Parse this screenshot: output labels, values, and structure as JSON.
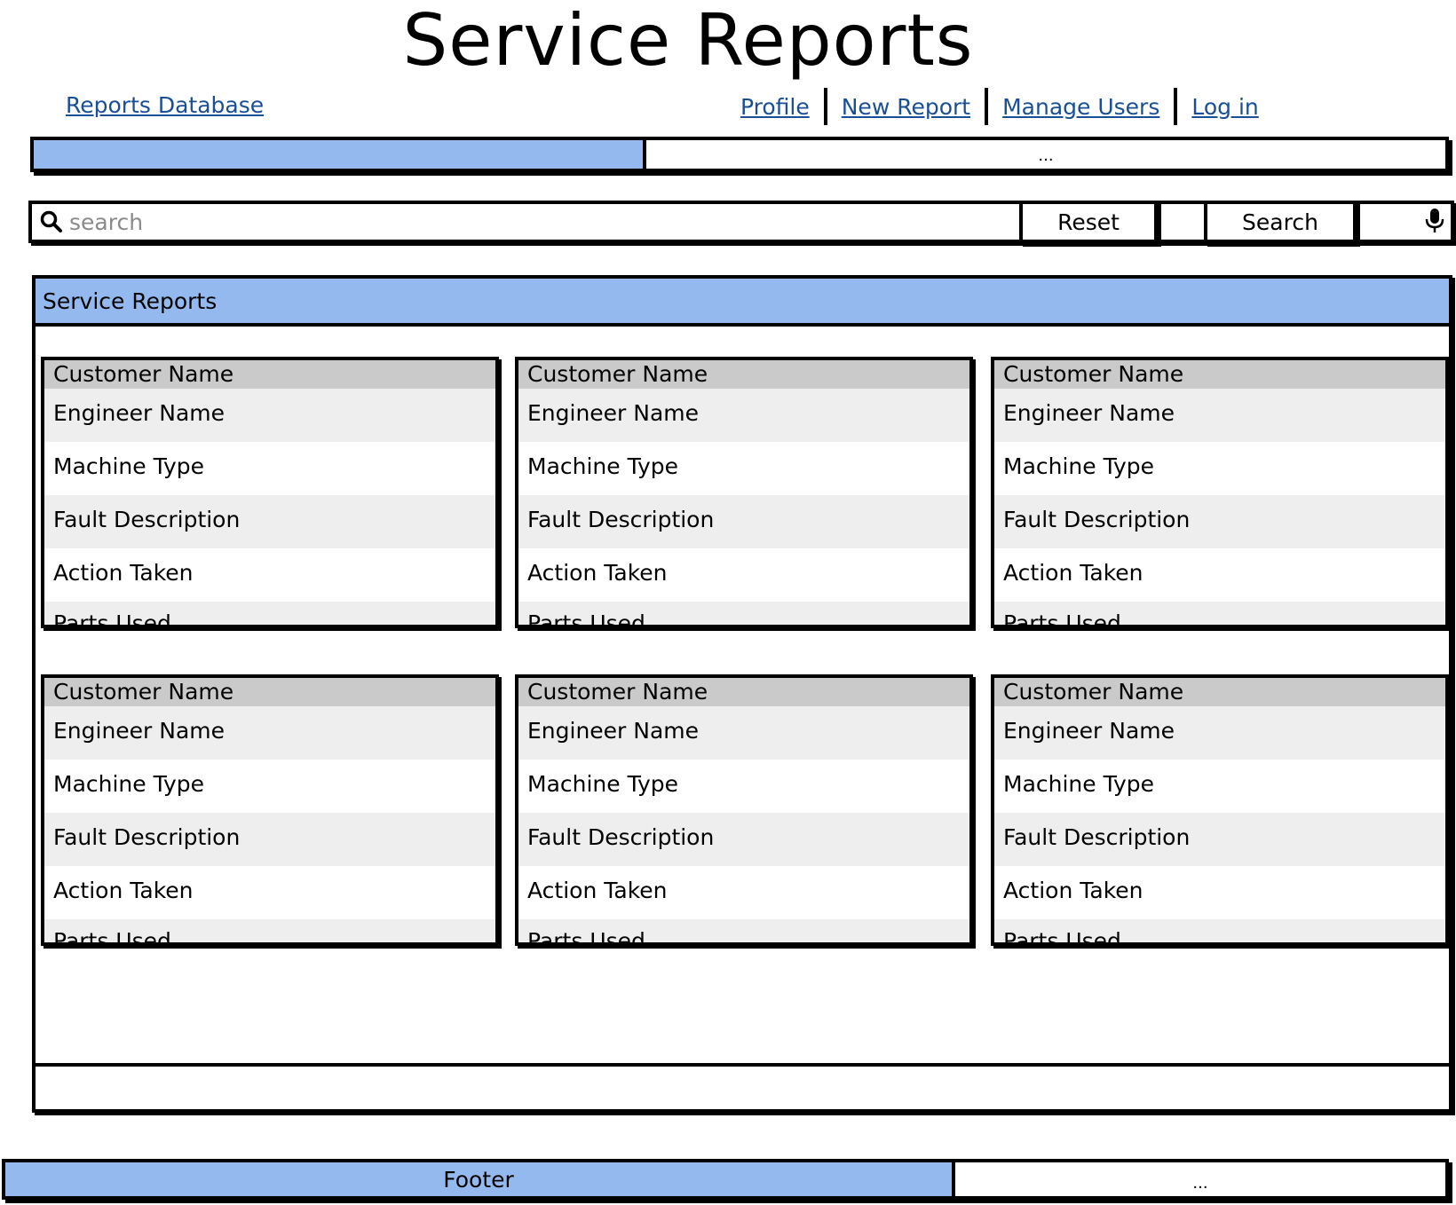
{
  "header": {
    "title": "Service Reports"
  },
  "nav": {
    "brand": "Reports Database",
    "links": [
      "Profile",
      "New Report",
      "Manage Users",
      "Log in"
    ]
  },
  "top_bar": {
    "more": "..."
  },
  "search": {
    "placeholder": "search",
    "reset_label": "Reset",
    "search_label": "Search"
  },
  "panel": {
    "title": "Service Reports",
    "cards": [
      {
        "header": "Customer Name",
        "fields": [
          "Engineer Name",
          "Machine Type",
          "Fault Description",
          "Action Taken",
          "Parts Used"
        ]
      },
      {
        "header": "Customer Name",
        "fields": [
          "Engineer Name",
          "Machine Type",
          "Fault Description",
          "Action Taken",
          "Parts Used"
        ]
      },
      {
        "header": "Customer Name",
        "fields": [
          "Engineer Name",
          "Machine Type",
          "Fault Description",
          "Action Taken",
          "Parts Used"
        ]
      },
      {
        "header": "Customer Name",
        "fields": [
          "Engineer Name",
          "Machine Type",
          "Fault Description",
          "Action Taken",
          "Parts Used"
        ]
      },
      {
        "header": "Customer Name",
        "fields": [
          "Engineer Name",
          "Machine Type",
          "Fault Description",
          "Action Taken",
          "Parts Used"
        ]
      },
      {
        "header": "Customer Name",
        "fields": [
          "Engineer Name",
          "Machine Type",
          "Fault Description",
          "Action Taken",
          "Parts Used"
        ]
      }
    ]
  },
  "footer": {
    "label": "Footer",
    "more": "..."
  },
  "colors": {
    "accent": "#93b9ef",
    "link": "#1a4f96",
    "card_header": "#cacaca",
    "row_alt": "#eeeeee"
  },
  "icons": {
    "search": "magnifier",
    "mic": "microphone"
  }
}
